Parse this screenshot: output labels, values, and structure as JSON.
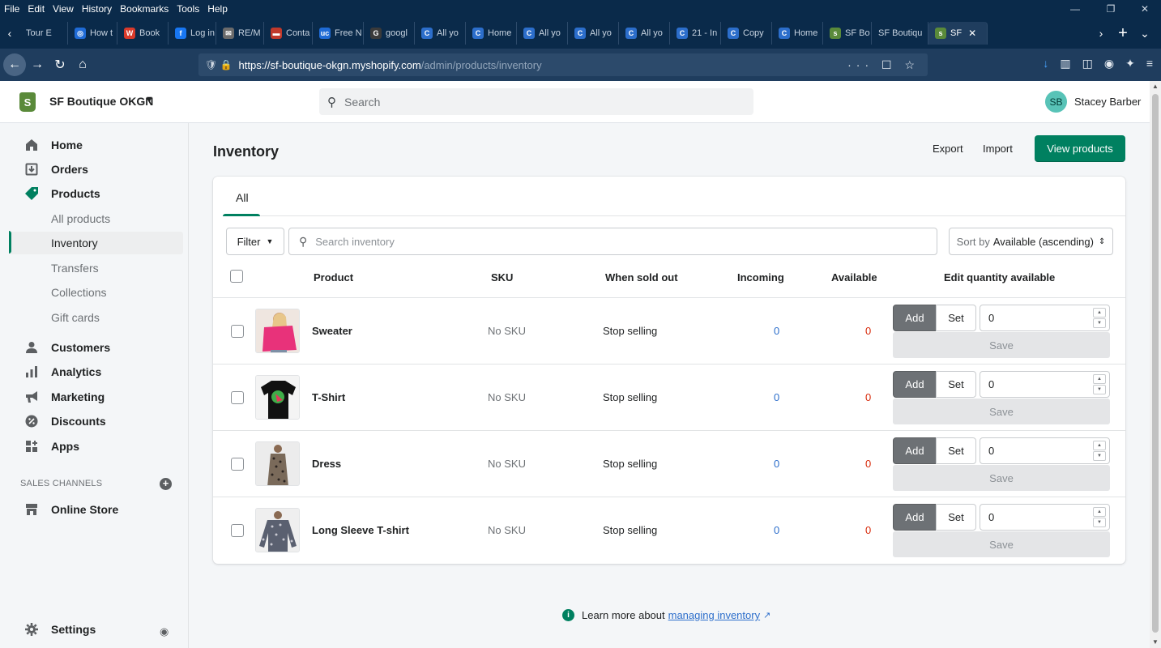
{
  "browser": {
    "menu": [
      "File",
      "Edit",
      "View",
      "History",
      "Bookmarks",
      "Tools",
      "Help"
    ],
    "tabs": [
      {
        "label": "Tour E",
        "fav": "",
        "color": "#0a2a4a"
      },
      {
        "label": "How t",
        "fav": "◎",
        "color": "#1f6bd6"
      },
      {
        "label": "Book",
        "fav": "W",
        "color": "#d93a2b"
      },
      {
        "label": "Log in",
        "fav": "f",
        "color": "#1877f2"
      },
      {
        "label": "RE/M",
        "fav": "✉",
        "color": "#6b6b6b"
      },
      {
        "label": "Conta",
        "fav": "▬",
        "color": "#c0392b"
      },
      {
        "label": "Free N",
        "fav": "uc",
        "color": "#1f6bd6"
      },
      {
        "label": "googl",
        "fav": "G",
        "color": "#3a3a3a"
      },
      {
        "label": "All yo",
        "fav": "C",
        "color": "#2c6ecb"
      },
      {
        "label": "Home",
        "fav": "C",
        "color": "#2c6ecb"
      },
      {
        "label": "All yo",
        "fav": "C",
        "color": "#2c6ecb"
      },
      {
        "label": "All yo",
        "fav": "C",
        "color": "#2c6ecb"
      },
      {
        "label": "All yo",
        "fav": "C",
        "color": "#2c6ecb"
      },
      {
        "label": "21 - In",
        "fav": "C",
        "color": "#2c6ecb"
      },
      {
        "label": "Copy",
        "fav": "C",
        "color": "#2c6ecb"
      },
      {
        "label": "Home",
        "fav": "C",
        "color": "#2c6ecb"
      },
      {
        "label": "SF Bo",
        "fav": "s",
        "color": "#5a8a3a"
      },
      {
        "label": "SF Boutiqu",
        "fav": "",
        "color": "#0a2a4a"
      },
      {
        "label": "SF",
        "fav": "s",
        "color": "#5a8a3a",
        "active": true
      }
    ],
    "url_host": "https://sf-boutique-okgn.myshopify.com",
    "url_path": "/admin/products/inventory"
  },
  "topbar": {
    "store_name": "SF Boutique OKGN",
    "store_initial": "S",
    "search_placeholder": "Search",
    "avatar_initials": "SB",
    "user_name": "Stacey Barber"
  },
  "sidebar": {
    "items": [
      {
        "label": "Home",
        "icon": "home-icon"
      },
      {
        "label": "Orders",
        "icon": "orders-icon"
      },
      {
        "label": "Products",
        "icon": "tag-icon"
      }
    ],
    "sub_items": [
      "All products",
      "Inventory",
      "Transfers",
      "Collections",
      "Gift cards"
    ],
    "items2": [
      {
        "label": "Customers",
        "icon": "person-icon"
      },
      {
        "label": "Analytics",
        "icon": "bar-chart-icon"
      },
      {
        "label": "Marketing",
        "icon": "megaphone-icon"
      },
      {
        "label": "Discounts",
        "icon": "discount-icon"
      },
      {
        "label": "Apps",
        "icon": "apps-icon"
      }
    ],
    "sales_channels_label": "SALES CHANNELS",
    "online_store": "Online Store",
    "settings": "Settings"
  },
  "main": {
    "title": "Inventory",
    "export_label": "Export",
    "import_label": "Import",
    "view_products_label": "View products",
    "tab_all": "All",
    "filter_label": "Filter",
    "search_placeholder": "Search inventory",
    "sort_prefix": "Sort by",
    "sort_value": "Available (ascending)",
    "columns": [
      "Product",
      "SKU",
      "When sold out",
      "Incoming",
      "Available",
      "Edit quantity available"
    ],
    "add_label": "Add",
    "set_label": "Set",
    "save_label": "Save",
    "rows": [
      {
        "product": "Sweater",
        "sku": "No SKU",
        "sold_out": "Stop selling",
        "incoming": "0",
        "available": "0",
        "qty": "0"
      },
      {
        "product": "T-Shirt",
        "sku": "No SKU",
        "sold_out": "Stop selling",
        "incoming": "0",
        "available": "0",
        "qty": "0"
      },
      {
        "product": "Dress",
        "sku": "No SKU",
        "sold_out": "Stop selling",
        "incoming": "0",
        "available": "0",
        "qty": "0"
      },
      {
        "product": "Long Sleeve T-shirt",
        "sku": "No SKU",
        "sold_out": "Stop selling",
        "incoming": "0",
        "available": "0",
        "qty": "0"
      }
    ],
    "learn_more_prefix": "Learn more about",
    "learn_more_link": "managing inventory"
  },
  "colors": {
    "accent": "#008060",
    "link": "#2c6ecb",
    "critical": "#d82c0d",
    "browser_bg": "#0a2a4a"
  }
}
